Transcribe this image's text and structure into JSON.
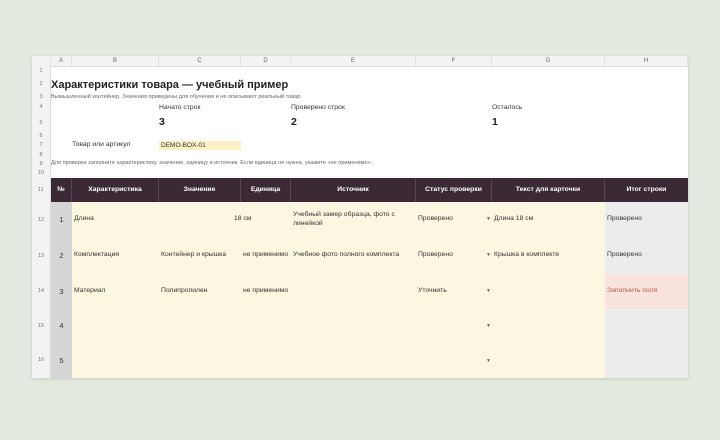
{
  "column_headers": [
    "A",
    "B",
    "C",
    "D",
    "E",
    "F",
    "G",
    "H"
  ],
  "row_numbers": [
    "1",
    "2",
    "3",
    "4",
    "5",
    "6",
    "7",
    "8",
    "9",
    "10",
    "11",
    "12",
    "13",
    "14",
    "15",
    "16"
  ],
  "title": "Характеристики товара — учебный пример",
  "subtitle": "Вымышленный контейнер. Значения приведены для обучения и не описывают реальный товар.",
  "stats": [
    {
      "label": "Начато строк",
      "value": "3"
    },
    {
      "label": "Проверено строк",
      "value": "2"
    },
    {
      "label": "Осталось",
      "value": "1"
    }
  ],
  "product_label": "Товар или артикул",
  "product_value": "DEMO-BOX-01",
  "instruction": "Для проверки заполните характеристику, значение, единицу и источник. Если единица не нужна, укажите «не применимо».",
  "table_headers": [
    "№",
    "Характеристика",
    "Значение",
    "Единица",
    "Источник",
    "Статус проверки",
    "Текст для карточки",
    "Итог строки"
  ],
  "rows": [
    {
      "n": "1",
      "char": "Длина",
      "value": "",
      "unit": "18 см",
      "source": "Учебный замер образца, фото с линейкой",
      "status": "Проверено",
      "card": "Длина 18 см",
      "result": "Проверено"
    },
    {
      "n": "2",
      "char": "Комплектация",
      "value": "Контейнер и крышка",
      "unit": "не применимо",
      "source": "Учебное фото полного комплекта",
      "status": "Проверено",
      "card": "Крышка в комплекте",
      "result": "Проверено"
    },
    {
      "n": "3",
      "char": "Материал",
      "value": "Полипропилен",
      "unit": "не применимо",
      "source": "",
      "status": "Уточнить",
      "card": "",
      "result": "Заполнить поля"
    },
    {
      "n": "4",
      "char": "",
      "value": "",
      "unit": "",
      "source": "",
      "status": "",
      "card": "",
      "result": ""
    },
    {
      "n": "5",
      "char": "",
      "value": "",
      "unit": "",
      "source": "",
      "status": "",
      "card": "",
      "result": ""
    }
  ],
  "dropdown_arrow": "▼",
  "colors": {
    "header_bg": "#3b2a35",
    "band_bg": "#fdf6e1",
    "result_ok": "#ececec",
    "result_warn": "#f9e3dd",
    "warn_text": "#c0573c"
  }
}
